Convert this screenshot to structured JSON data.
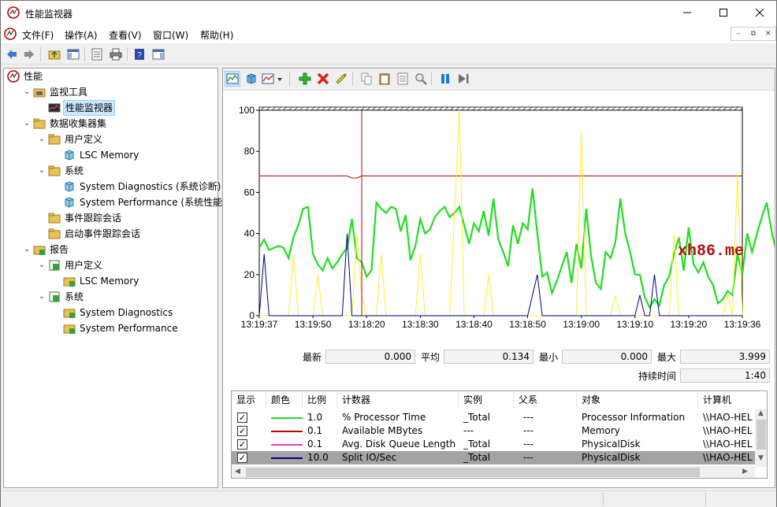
{
  "window": {
    "title": "性能监视器"
  },
  "menu": [
    "文件(F)",
    "操作(A)",
    "查看(V)",
    "窗口(W)",
    "帮助(H)"
  ],
  "mdi_buttons": [
    "–",
    "⧉",
    "✕"
  ],
  "tree": [
    {
      "label": "性能",
      "level": 0,
      "expander": "",
      "icon": "perf-icon"
    },
    {
      "label": "监视工具",
      "level": 1,
      "expander": "⌄",
      "icon": "folder-tools-icon"
    },
    {
      "label": "性能监视器",
      "level": 2,
      "expander": "",
      "icon": "monitor-icon",
      "selected": true
    },
    {
      "label": "数据收集器集",
      "level": 1,
      "expander": "⌄",
      "icon": "folder-icon"
    },
    {
      "label": "用户定义",
      "level": 2,
      "expander": "⌄",
      "icon": "folder-icon"
    },
    {
      "label": "LSC Memory",
      "level": 3,
      "expander": "",
      "icon": "collector-icon"
    },
    {
      "label": "系统",
      "level": 2,
      "expander": "⌄",
      "icon": "folder-icon"
    },
    {
      "label": "System Diagnostics (系统诊断)",
      "level": 3,
      "expander": "",
      "icon": "collector-icon"
    },
    {
      "label": "System Performance (系统性能)",
      "level": 3,
      "expander": "",
      "icon": "collector-icon"
    },
    {
      "label": "事件跟踪会话",
      "level": 2,
      "expander": "",
      "icon": "folder-icon"
    },
    {
      "label": "启动事件跟踪会话",
      "level": 2,
      "expander": "",
      "icon": "folder-icon"
    },
    {
      "label": "报告",
      "level": 1,
      "expander": "⌄",
      "icon": "report-folder-icon"
    },
    {
      "label": "用户定义",
      "level": 2,
      "expander": "⌄",
      "icon": "report-icon"
    },
    {
      "label": "LSC Memory",
      "level": 3,
      "expander": "",
      "icon": "report-folder-icon"
    },
    {
      "label": "系统",
      "level": 2,
      "expander": "⌄",
      "icon": "report-icon"
    },
    {
      "label": "System Diagnostics",
      "level": 3,
      "expander": "",
      "icon": "report-folder-icon"
    },
    {
      "label": "System Performance",
      "level": 3,
      "expander": "",
      "icon": "report-folder-icon"
    }
  ],
  "watermark": "xh86.me",
  "stats": {
    "last_label": "最新",
    "last_value": "0.000",
    "avg_label": "平均",
    "avg_value": "0.134",
    "min_label": "最小",
    "min_value": "0.000",
    "max_label": "最大",
    "max_value": "3.999",
    "duration_label": "持续时间",
    "duration_value": "1:40"
  },
  "table": {
    "headers": [
      "显示",
      "颜色",
      "比例",
      "计数器",
      "实例",
      "父系",
      "对象",
      "计算机"
    ],
    "rows": [
      {
        "checked": "✓",
        "color": "#22dd22",
        "scale": "1.0",
        "counter": "% Processor Time",
        "instance": "_Total",
        "parent": "---",
        "object": "Processor Information",
        "computer": "\\\\HAO-HEL"
      },
      {
        "checked": "✓",
        "color": "#c00000",
        "scale": "0.1",
        "counter": "Available MBytes",
        "instance": "---",
        "parent": "---",
        "object": "Memory",
        "computer": "\\\\HAO-HEL"
      },
      {
        "checked": "✓",
        "color": "#e040e0",
        "scale": "0.1",
        "counter": "Avg. Disk Queue Length",
        "instance": "_Total",
        "parent": "---",
        "object": "PhysicalDisk",
        "computer": "\\\\HAO-HEL"
      },
      {
        "checked": "✓",
        "color": "#000080",
        "scale": "10.0",
        "counter": "Split IO/Sec",
        "instance": "_Total",
        "parent": "---",
        "object": "PhysicalDisk",
        "computer": "\\\\HAO-HEL",
        "selected": true
      }
    ]
  },
  "chart_data": {
    "type": "line",
    "ylim": [
      0,
      100
    ],
    "yticks": [
      0,
      20,
      40,
      60,
      80,
      100
    ],
    "x_tick_labels": [
      "13:19:37",
      "13:19:50",
      "13:18:20",
      "13:18:30",
      "13:18:40",
      "13:18:50",
      "13:19:00",
      "13:19:10",
      "13:19:20",
      "13:19:36"
    ],
    "samples": 100,
    "current_index": 21,
    "grid": false,
    "series": [
      {
        "name": "% Processor Time",
        "color": "#22dd22",
        "values": [
          33,
          37,
          32,
          33,
          34,
          33,
          28,
          38,
          44,
          52,
          53,
          30,
          25,
          22,
          28,
          23,
          26,
          30,
          33,
          47,
          28,
          26,
          19,
          22,
          55,
          52,
          50,
          53,
          52,
          41,
          49,
          27,
          34,
          47,
          40,
          42,
          48,
          51,
          53,
          48,
          50,
          53,
          44,
          35,
          45,
          41,
          51,
          39,
          57,
          37,
          31,
          24,
          44,
          35,
          45,
          42,
          62,
          40,
          19,
          21,
          11,
          17,
          24,
          31,
          16,
          35,
          23,
          52,
          29,
          16,
          13,
          31,
          28,
          36,
          57,
          40,
          31,
          20,
          20,
          9,
          4,
          8,
          5,
          15,
          19,
          30,
          38,
          22,
          43,
          25,
          21,
          26,
          19,
          15,
          6,
          8,
          12,
          10,
          30,
          20,
          40,
          31,
          40,
          48,
          55,
          41,
          31,
          46,
          56
        ]
      },
      {
        "name": "Available MBytes",
        "color": "#c00000",
        "values": [
          68,
          68,
          68,
          68,
          68,
          68,
          68,
          68,
          68,
          68,
          68,
          68,
          68,
          68,
          68,
          68,
          68,
          68,
          68,
          67,
          67,
          68,
          68,
          68,
          68,
          68,
          68,
          68,
          68,
          68,
          68,
          68,
          68,
          68,
          68,
          68,
          68,
          68,
          68,
          68,
          68,
          68,
          68,
          68,
          68,
          68,
          68,
          68,
          68,
          68,
          68,
          68,
          68,
          68,
          68,
          68,
          68,
          68,
          68,
          68,
          68,
          68,
          68,
          68,
          68,
          68,
          68,
          68,
          68,
          68,
          68,
          68,
          68,
          68,
          68,
          68,
          68,
          68,
          68,
          68,
          68,
          68,
          68,
          68,
          68,
          68,
          68,
          68,
          68,
          68,
          68,
          68,
          68,
          68,
          68,
          68,
          68,
          68,
          68,
          68
        ]
      },
      {
        "name": "Avg. Disk Queue Length",
        "color": "#ffee33",
        "values": [
          0,
          0,
          0,
          0,
          0,
          0,
          0,
          30,
          0,
          0,
          0,
          0,
          20,
          0,
          0,
          0,
          0,
          0,
          0,
          0,
          40,
          10,
          0,
          0,
          0,
          30,
          0,
          0,
          0,
          0,
          0,
          0,
          0,
          30,
          0,
          0,
          0,
          0,
          0,
          0,
          50,
          100,
          0,
          0,
          0,
          0,
          0,
          20,
          0,
          0,
          0,
          0,
          0,
          0,
          0,
          0,
          0,
          0,
          0,
          0,
          0,
          0,
          0,
          0,
          0,
          0,
          90,
          0,
          0,
          0,
          0,
          0,
          0,
          10,
          0,
          0,
          0,
          0,
          0,
          0,
          0,
          0,
          0,
          0,
          0,
          40,
          0,
          0,
          0,
          0,
          0,
          0,
          0,
          0,
          0,
          0,
          10,
          0,
          70,
          0
        ]
      },
      {
        "name": "Split IO/Sec",
        "color": "#000080",
        "values": [
          0,
          30,
          0,
          0,
          0,
          0,
          0,
          0,
          0,
          0,
          0,
          0,
          0,
          0,
          0,
          0,
          0,
          0,
          40,
          0,
          0,
          0,
          0,
          0,
          0,
          0,
          0,
          0,
          0,
          0,
          0,
          0,
          0,
          0,
          0,
          0,
          0,
          0,
          0,
          0,
          0,
          0,
          0,
          0,
          0,
          0,
          0,
          0,
          0,
          0,
          0,
          0,
          0,
          0,
          0,
          0,
          10,
          20,
          0,
          0,
          0,
          0,
          0,
          0,
          0,
          0,
          0,
          0,
          0,
          0,
          0,
          0,
          0,
          0,
          0,
          0,
          0,
          0,
          10,
          0,
          0,
          20,
          0,
          0,
          0,
          0,
          0,
          0,
          0,
          0,
          0,
          0,
          0,
          0,
          0,
          0,
          0,
          0,
          0,
          0
        ]
      }
    ]
  }
}
